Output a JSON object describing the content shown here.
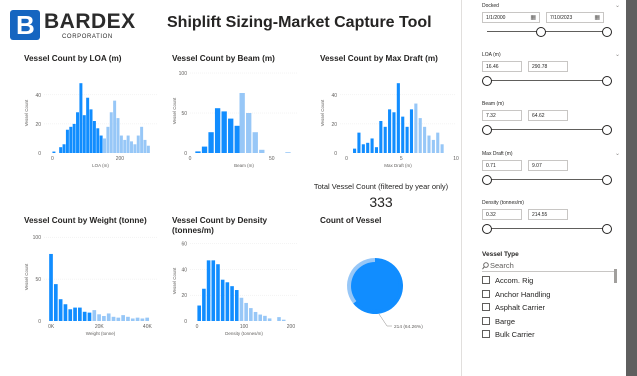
{
  "header": {
    "logo_letter": "B",
    "logo_name": "BARDEX",
    "logo_sub": "CORPORATION",
    "title": "Shiplift Sizing-Market Capture Tool"
  },
  "colors": {
    "primary": "#118dff",
    "light": "#97c7f7",
    "handle_border": "#252423"
  },
  "chart_data": [
    {
      "id": "loa",
      "type": "bar",
      "title": "Vessel Count by LOA (m)",
      "xlabel": "LOA (m)",
      "ylabel": "Vessel Count",
      "xlim": [
        -25,
        310
      ],
      "ylim": [
        0,
        55
      ],
      "xticks": [
        0,
        200
      ],
      "yticks": [
        0,
        20,
        40
      ],
      "bin_width": 10,
      "bars": [
        {
          "x": 5,
          "y": 1,
          "tone": "primary"
        },
        {
          "x": 25,
          "y": 4,
          "tone": "primary"
        },
        {
          "x": 35,
          "y": 6,
          "tone": "primary"
        },
        {
          "x": 45,
          "y": 16,
          "tone": "primary"
        },
        {
          "x": 55,
          "y": 18,
          "tone": "primary"
        },
        {
          "x": 65,
          "y": 20,
          "tone": "primary"
        },
        {
          "x": 75,
          "y": 28,
          "tone": "primary"
        },
        {
          "x": 85,
          "y": 48,
          "tone": "primary"
        },
        {
          "x": 95,
          "y": 26,
          "tone": "primary"
        },
        {
          "x": 105,
          "y": 38,
          "tone": "primary"
        },
        {
          "x": 115,
          "y": 30,
          "tone": "primary"
        },
        {
          "x": 125,
          "y": 22,
          "tone": "primary"
        },
        {
          "x": 135,
          "y": 17,
          "tone": "primary"
        },
        {
          "x": 145,
          "y": 12,
          "tone": "primary"
        },
        {
          "x": 155,
          "y": 10,
          "tone": "light"
        },
        {
          "x": 165,
          "y": 18,
          "tone": "light"
        },
        {
          "x": 175,
          "y": 28,
          "tone": "light"
        },
        {
          "x": 185,
          "y": 36,
          "tone": "light"
        },
        {
          "x": 195,
          "y": 24,
          "tone": "light"
        },
        {
          "x": 205,
          "y": 12,
          "tone": "light"
        },
        {
          "x": 215,
          "y": 9,
          "tone": "light"
        },
        {
          "x": 225,
          "y": 12,
          "tone": "light"
        },
        {
          "x": 235,
          "y": 8,
          "tone": "light"
        },
        {
          "x": 245,
          "y": 6,
          "tone": "light"
        },
        {
          "x": 255,
          "y": 12,
          "tone": "light"
        },
        {
          "x": 265,
          "y": 18,
          "tone": "light"
        },
        {
          "x": 275,
          "y": 9,
          "tone": "light"
        },
        {
          "x": 285,
          "y": 5,
          "tone": "light"
        }
      ]
    },
    {
      "id": "beam",
      "type": "bar",
      "title": "Vessel Count by Beam (m)",
      "xlabel": "Beam (m)",
      "ylabel": "Vessel Count",
      "xlim": [
        0,
        66
      ],
      "ylim": [
        0,
        105
      ],
      "xticks": [
        0,
        50
      ],
      "yticks": [
        0,
        50,
        100
      ],
      "bin_width": 3.5,
      "bars": [
        {
          "x": 5,
          "y": 2,
          "tone": "primary"
        },
        {
          "x": 9,
          "y": 8,
          "tone": "primary"
        },
        {
          "x": 13,
          "y": 26,
          "tone": "primary"
        },
        {
          "x": 17,
          "y": 56,
          "tone": "primary"
        },
        {
          "x": 21,
          "y": 52,
          "tone": "primary"
        },
        {
          "x": 25,
          "y": 43,
          "tone": "primary"
        },
        {
          "x": 29,
          "y": 34,
          "tone": "primary"
        },
        {
          "x": 32,
          "y": 75,
          "tone": "light"
        },
        {
          "x": 36,
          "y": 50,
          "tone": "light"
        },
        {
          "x": 40,
          "y": 26,
          "tone": "light"
        },
        {
          "x": 44,
          "y": 4,
          "tone": "light"
        },
        {
          "x": 60,
          "y": 1,
          "tone": "light"
        }
      ]
    },
    {
      "id": "draft",
      "type": "bar",
      "title": "Vessel Count by Max Draft (m)",
      "xlabel": "Max Draft (m)",
      "ylabel": "Vessel Count",
      "xlim": [
        -0.6,
        10
      ],
      "ylim": [
        0,
        55
      ],
      "xticks": [
        0,
        5,
        10
      ],
      "yticks": [
        0,
        20,
        40
      ],
      "bin_width": 0.32,
      "bars": [
        {
          "x": 0.75,
          "y": 3,
          "tone": "primary"
        },
        {
          "x": 1.15,
          "y": 14,
          "tone": "primary"
        },
        {
          "x": 1.55,
          "y": 6,
          "tone": "primary"
        },
        {
          "x": 1.95,
          "y": 7,
          "tone": "primary"
        },
        {
          "x": 2.35,
          "y": 10,
          "tone": "primary"
        },
        {
          "x": 2.75,
          "y": 4,
          "tone": "primary"
        },
        {
          "x": 3.15,
          "y": 22,
          "tone": "primary"
        },
        {
          "x": 3.55,
          "y": 18,
          "tone": "primary"
        },
        {
          "x": 3.95,
          "y": 30,
          "tone": "primary"
        },
        {
          "x": 4.35,
          "y": 28,
          "tone": "primary"
        },
        {
          "x": 4.75,
          "y": 48,
          "tone": "primary"
        },
        {
          "x": 5.15,
          "y": 25,
          "tone": "primary"
        },
        {
          "x": 5.55,
          "y": 18,
          "tone": "primary"
        },
        {
          "x": 5.95,
          "y": 30,
          "tone": "primary"
        },
        {
          "x": 6.35,
          "y": 34,
          "tone": "light"
        },
        {
          "x": 6.75,
          "y": 24,
          "tone": "light"
        },
        {
          "x": 7.15,
          "y": 18,
          "tone": "light"
        },
        {
          "x": 7.55,
          "y": 12,
          "tone": "light"
        },
        {
          "x": 7.95,
          "y": 9,
          "tone": "light"
        },
        {
          "x": 8.35,
          "y": 14,
          "tone": "light"
        },
        {
          "x": 8.75,
          "y": 6,
          "tone": "light"
        }
      ]
    },
    {
      "id": "weight",
      "type": "bar",
      "title": "Vessel Count by Weight (tonne)",
      "xlabel": "Weight (tonne)",
      "ylabel": "Vessel Count",
      "xlim": [
        -3000,
        44000
      ],
      "ylim": [
        0,
        105
      ],
      "xticks": [
        0,
        20000,
        40000
      ],
      "xtick_labels": [
        "0K",
        "20K",
        "40K"
      ],
      "yticks": [
        0,
        50,
        100
      ],
      "bin_width": 1700,
      "bars": [
        {
          "x": 0,
          "y": 80,
          "tone": "primary"
        },
        {
          "x": 2000,
          "y": 44,
          "tone": "primary"
        },
        {
          "x": 4000,
          "y": 26,
          "tone": "primary"
        },
        {
          "x": 6000,
          "y": 20,
          "tone": "primary"
        },
        {
          "x": 8000,
          "y": 14,
          "tone": "primary"
        },
        {
          "x": 10000,
          "y": 16,
          "tone": "primary"
        },
        {
          "x": 12000,
          "y": 16,
          "tone": "primary"
        },
        {
          "x": 14000,
          "y": 11,
          "tone": "primary"
        },
        {
          "x": 16000,
          "y": 10,
          "tone": "primary"
        },
        {
          "x": 18000,
          "y": 13,
          "tone": "light"
        },
        {
          "x": 20000,
          "y": 8,
          "tone": "light"
        },
        {
          "x": 22000,
          "y": 6,
          "tone": "light"
        },
        {
          "x": 24000,
          "y": 9,
          "tone": "light"
        },
        {
          "x": 26000,
          "y": 5,
          "tone": "light"
        },
        {
          "x": 28000,
          "y": 4,
          "tone": "light"
        },
        {
          "x": 30000,
          "y": 7,
          "tone": "light"
        },
        {
          "x": 32000,
          "y": 5,
          "tone": "light"
        },
        {
          "x": 34000,
          "y": 3,
          "tone": "light"
        },
        {
          "x": 36000,
          "y": 4,
          "tone": "light"
        },
        {
          "x": 38000,
          "y": 3,
          "tone": "light"
        },
        {
          "x": 40000,
          "y": 4,
          "tone": "light"
        }
      ]
    },
    {
      "id": "density",
      "type": "bar",
      "title": "Vessel Count by Density (tonnes/m)",
      "xlabel": "Density (tonnes/m)",
      "ylabel": "Vessel Count",
      "xlim": [
        -15,
        215
      ],
      "ylim": [
        0,
        62
      ],
      "xticks": [
        0,
        100,
        200
      ],
      "yticks": [
        0,
        20,
        40,
        60
      ],
      "bin_width": 8.5,
      "bars": [
        {
          "x": 5,
          "y": 12,
          "tone": "primary"
        },
        {
          "x": 15,
          "y": 25,
          "tone": "primary"
        },
        {
          "x": 25,
          "y": 47,
          "tone": "primary"
        },
        {
          "x": 35,
          "y": 47,
          "tone": "primary"
        },
        {
          "x": 45,
          "y": 44,
          "tone": "primary"
        },
        {
          "x": 55,
          "y": 32,
          "tone": "primary"
        },
        {
          "x": 65,
          "y": 30,
          "tone": "primary"
        },
        {
          "x": 75,
          "y": 27,
          "tone": "primary"
        },
        {
          "x": 85,
          "y": 24,
          "tone": "primary"
        },
        {
          "x": 95,
          "y": 18,
          "tone": "light"
        },
        {
          "x": 105,
          "y": 14,
          "tone": "light"
        },
        {
          "x": 115,
          "y": 10,
          "tone": "light"
        },
        {
          "x": 125,
          "y": 7,
          "tone": "light"
        },
        {
          "x": 135,
          "y": 5,
          "tone": "light"
        },
        {
          "x": 145,
          "y": 4,
          "tone": "light"
        },
        {
          "x": 155,
          "y": 2,
          "tone": "light"
        },
        {
          "x": 175,
          "y": 3,
          "tone": "light"
        },
        {
          "x": 185,
          "y": 1,
          "tone": "light"
        }
      ]
    },
    {
      "id": "count",
      "type": "pie",
      "title": "Count of Vessel",
      "slices": [
        {
          "value": 214,
          "label": "214 (64.26%)",
          "tone": "primary"
        },
        {
          "value": 119,
          "label": "",
          "tone": "light"
        }
      ]
    }
  ],
  "kpi": {
    "label": "Total Vessel Count (filtered by year only)",
    "value": "333"
  },
  "slicers": [
    {
      "id": "docked",
      "label": "Docked",
      "type": "date",
      "from": "1/1/2000",
      "to": "7/10/2023",
      "min": 0,
      "max": 1,
      "low": 0.45,
      "high": 1,
      "has_chevron": true
    },
    {
      "id": "loa",
      "label": "LOA (m)",
      "type": "num",
      "from": "16.46",
      "to": "290.78",
      "min": 0,
      "max": 1,
      "low": 0,
      "high": 1,
      "has_chevron": true
    },
    {
      "id": "beam",
      "label": "Beam (m)",
      "type": "num",
      "from": "7.32",
      "to": "64.62",
      "min": 0,
      "max": 1,
      "low": 0,
      "high": 1,
      "has_chevron": false
    },
    {
      "id": "draft",
      "label": "Max Draft (m)",
      "type": "num",
      "from": "0.71",
      "to": "9.07",
      "min": 0,
      "max": 1,
      "low": 0,
      "high": 1,
      "has_chevron": true
    },
    {
      "id": "density",
      "label": "Density (tonnes/m)",
      "type": "num",
      "from": "0.32",
      "to": "214.55",
      "min": 0,
      "max": 1,
      "low": 0,
      "high": 1,
      "has_chevron": false
    }
  ],
  "vessel_type": {
    "label": "Vessel Type",
    "search_placeholder": "Search",
    "items": [
      "Accom. Rig",
      "Anchor Handling",
      "Asphalt Carrier",
      "Barge",
      "Bulk Carrier"
    ]
  },
  "icons": {
    "calendar": "calendar-icon",
    "chevron": "chevron-down-icon",
    "search": "search-icon"
  }
}
